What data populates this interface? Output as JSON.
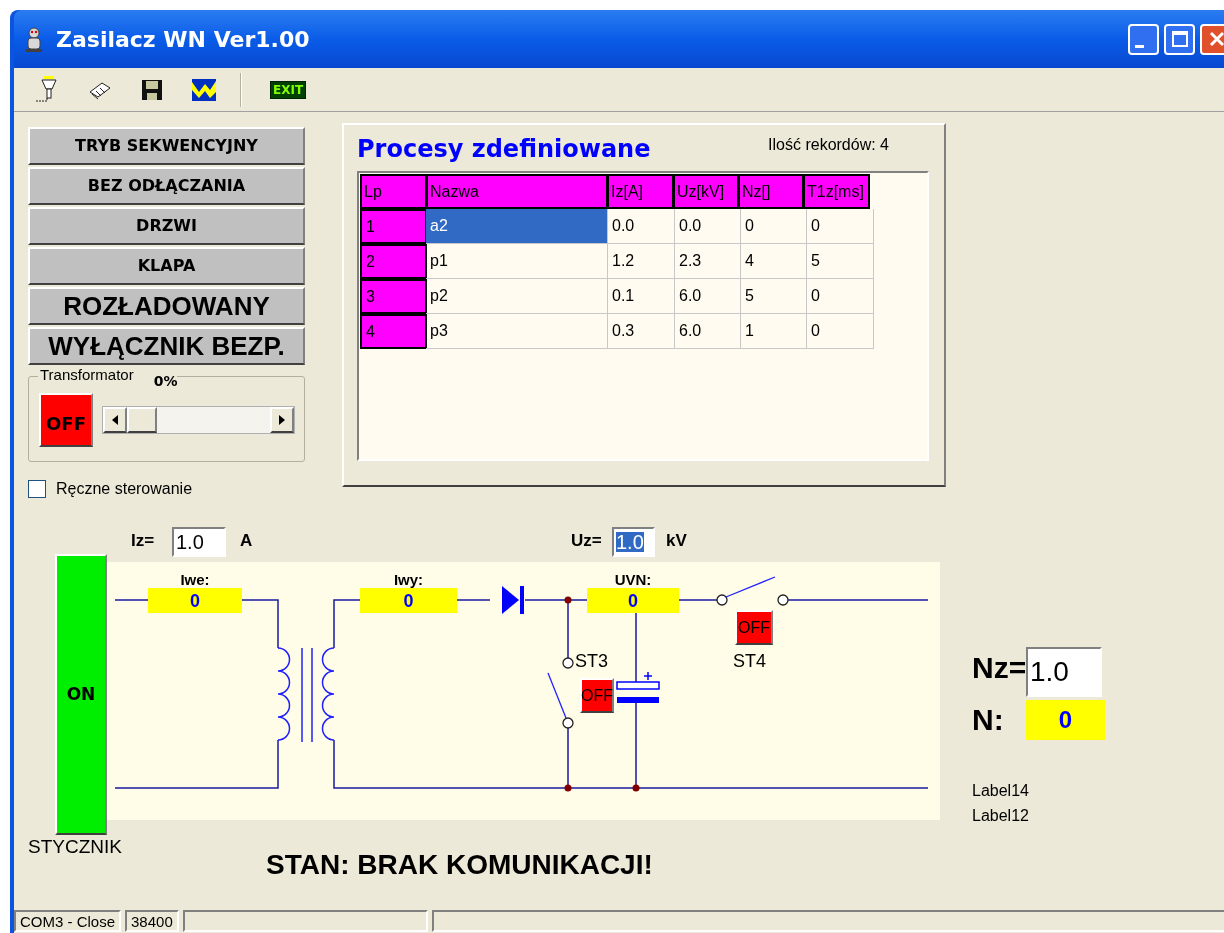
{
  "window": {
    "title": "Zasilacz WN Ver1.00"
  },
  "toolbar": {
    "exit_label": "EXIT"
  },
  "mode_buttons": [
    {
      "label": "TRYB SEKWENCYJNY",
      "kind": "small"
    },
    {
      "label": "BEZ ODŁĄCZANIA",
      "kind": "small"
    },
    {
      "label": "DRZWI",
      "kind": "small"
    },
    {
      "label": "KLAPA",
      "kind": "small"
    },
    {
      "label": "ROZŁADOWANY",
      "kind": "large"
    },
    {
      "label": "WYŁĄCZNIK BEZP.",
      "kind": "large"
    }
  ],
  "transformator": {
    "title": "Transformator",
    "reading": "0%",
    "power": {
      "label": "OFF",
      "on": false
    },
    "level": 0
  },
  "manual_control": {
    "label": "Ręczne sterowanie",
    "checked": false
  },
  "processes": {
    "title": "Procesy zdefiniowane",
    "record_count": "Ilość rekordów: 4",
    "columns": [
      "Lp",
      "Nazwa",
      "Iz[A]",
      "Uz[kV]",
      "Nz[]",
      "T1z[ms]"
    ],
    "rows": [
      {
        "cells": [
          "1",
          "a2",
          "0.0",
          "0.0",
          "0",
          "0"
        ],
        "selected": true
      },
      {
        "cells": [
          "2",
          "p1",
          "1.2",
          "2.3",
          "4",
          "5"
        ],
        "selected": false
      },
      {
        "cells": [
          "3",
          "p2",
          "0.1",
          "6.0",
          "5",
          "0"
        ],
        "selected": false
      },
      {
        "cells": [
          "4",
          "p3",
          "0.3",
          "6.0",
          "1",
          "0"
        ],
        "selected": false
      }
    ]
  },
  "setpoints": {
    "current": {
      "label": "Iz=",
      "value": "1.0",
      "unit": "A",
      "selected": false
    },
    "voltage": {
      "label": "Uz=",
      "value": "1.0",
      "unit": "kV",
      "selected": true
    }
  },
  "contactor": {
    "state": "ON",
    "on": true,
    "label": "STYCZNIK"
  },
  "circuit": {
    "meters": [
      {
        "label": "Iwe:",
        "value": "0"
      },
      {
        "label": "Iwy:",
        "value": "0"
      },
      {
        "label": "UVN:",
        "value": "0"
      }
    ],
    "switches": [
      {
        "name": "ST3",
        "state": "OFF",
        "on": false
      },
      {
        "name": "ST4",
        "state": "OFF",
        "on": false
      }
    ]
  },
  "counter": {
    "nz_label": "Nz=",
    "nz_value": "1.0",
    "n_label": "N:",
    "n_value": "0"
  },
  "labels": [
    "Label14",
    "Label12"
  ],
  "status_text": "STAN: BRAK KOMUNIKACJI!",
  "status_bar": [
    "COM3 - Close",
    "38400"
  ]
}
